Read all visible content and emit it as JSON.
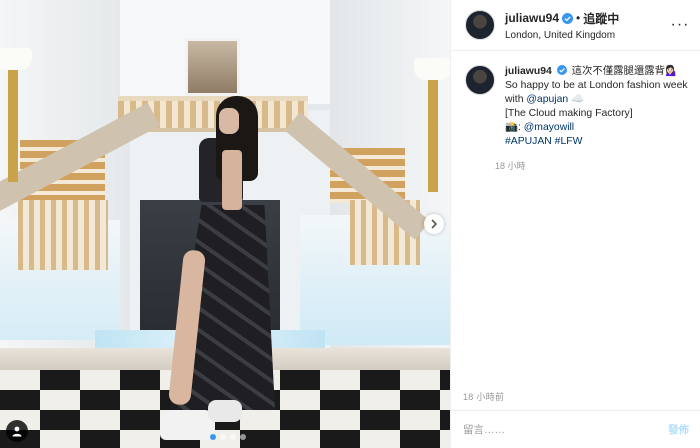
{
  "header": {
    "username": "juliawu94",
    "separator": "•",
    "follow_label": "追蹤中",
    "location": "London, United Kingdom",
    "more_label": "···"
  },
  "caption": {
    "username": "juliawu94",
    "text_line1": "這次不僅露腿還露背",
    "emoji1": "💁🏻‍♀️",
    "text_line2": "So happy to be at London fashion week",
    "text_line3_prefix": "with ",
    "mention1": "@apujan",
    "emoji2": "☁️",
    "text_line4": "[The Cloud making Factory]",
    "emoji3": "📸",
    "text_line5_prefix": ": ",
    "mention2": "@mayowill",
    "hashtag1": "#APUJAN",
    "hashtag2": "#LFW",
    "time": "18 小時"
  },
  "post": {
    "time_ago": "18 小時前",
    "carousel_total": 4,
    "carousel_active": 1
  },
  "comment_box": {
    "placeholder": "留言……",
    "post_label": "發佈"
  },
  "colors": {
    "verified": "#3897f0",
    "link": "#003569",
    "muted": "#999999",
    "post_button_disabled": "#b2dffc"
  },
  "icons": [
    "verified-badge-icon",
    "more-options-icon",
    "chevron-right-icon",
    "user-tag-icon"
  ]
}
